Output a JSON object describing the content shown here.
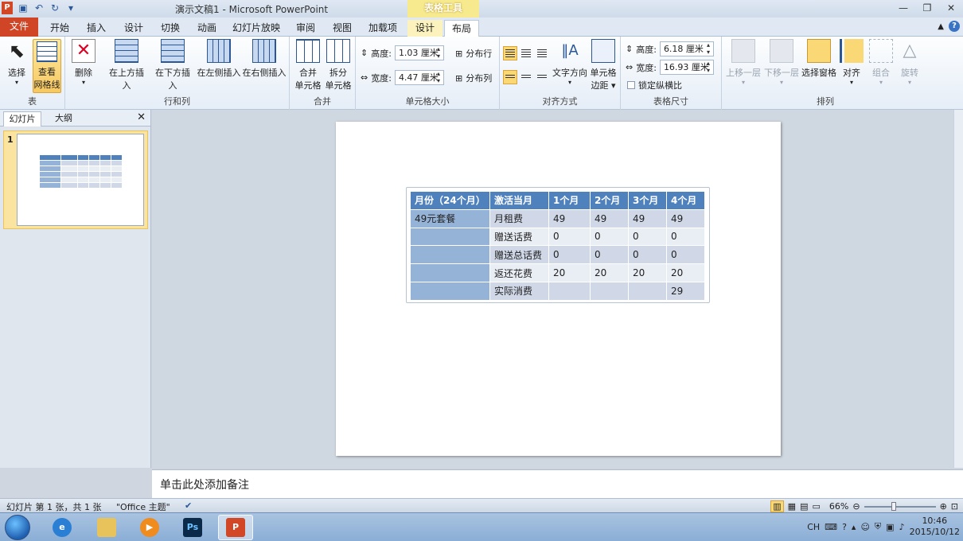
{
  "window": {
    "title": "演示文稿1 - Microsoft PowerPoint",
    "context_tab": "表格工具",
    "controls": [
      "—",
      "❐",
      "✕"
    ]
  },
  "tabs": {
    "file": "文件",
    "items": [
      "开始",
      "插入",
      "设计",
      "切换",
      "动画",
      "幻灯片放映",
      "审阅",
      "视图",
      "加载项"
    ],
    "tool_design": "设计",
    "tool_layout": "布局"
  },
  "ribbon": {
    "table_group": {
      "label": "表",
      "select": "选择",
      "view_grid_1": "查看",
      "view_grid_2": "网格线"
    },
    "rows_cols_group": {
      "label": "行和列",
      "delete": "删除",
      "insert_above": "在上方插入",
      "insert_below": "在下方插入",
      "insert_left": "在左侧插入",
      "insert_right": "在右侧插入"
    },
    "merge_group": {
      "label": "合并",
      "merge_1": "合并",
      "merge_2": "单元格",
      "split_1": "拆分",
      "split_2": "单元格"
    },
    "cell_size_group": {
      "label": "单元格大小",
      "height_label": "高度:",
      "height_value": "1.03 厘米",
      "width_label": "宽度:",
      "width_value": "4.47 厘米",
      "distribute_rows": "分布行",
      "distribute_cols": "分布列"
    },
    "alignment_group": {
      "label": "对齐方式",
      "text_dir": "文字方向",
      "cell_margin_1": "单元格",
      "cell_margin_2": "边距"
    },
    "table_size_group": {
      "label": "表格尺寸",
      "height_label": "高度:",
      "height_value": "6.18 厘米",
      "width_label": "宽度:",
      "width_value": "16.93 厘米",
      "lock_ratio": "锁定纵横比"
    },
    "arrange_group": {
      "label": "排列",
      "bring_forward": "上移一层",
      "send_backward": "下移一层",
      "selection_pane": "选择窗格",
      "align": "对齐",
      "group": "组合",
      "rotate": "旋转"
    }
  },
  "left_pane": {
    "tab_slides": "幻灯片",
    "tab_outline": "大纲",
    "slide_number": "1"
  },
  "slide_table": {
    "header": [
      "月份（24个月）",
      "激活当月",
      "1个月",
      "2个月",
      "3个月",
      "4个月"
    ],
    "package": "49元套餐",
    "rows": [
      [
        "月租费",
        "49",
        "49",
        "49",
        "49"
      ],
      [
        "赠送话费",
        "0",
        "0",
        "0",
        "0"
      ],
      [
        "赠送总话费",
        "0",
        "0",
        "0",
        "0"
      ],
      [
        "返还花费",
        "20",
        "20",
        "20",
        "20"
      ],
      [
        "实际消费",
        "",
        "",
        "",
        "29"
      ]
    ]
  },
  "notes": {
    "placeholder": "单击此处添加备注"
  },
  "status": {
    "slide_info": "幻灯片 第 1 张，共 1 张",
    "theme": "\"Office 主题\"",
    "zoom": "66%"
  },
  "taskbar": {
    "ime": "CH",
    "time": "10:46",
    "date": "2015/10/12"
  },
  "colors": {
    "accent_file": "#d04525",
    "table_header": "#4f81bd",
    "table_band_dark": "#d0d8e8",
    "table_band_light": "#e9edf4",
    "table_first_col": "#95b3d7"
  }
}
